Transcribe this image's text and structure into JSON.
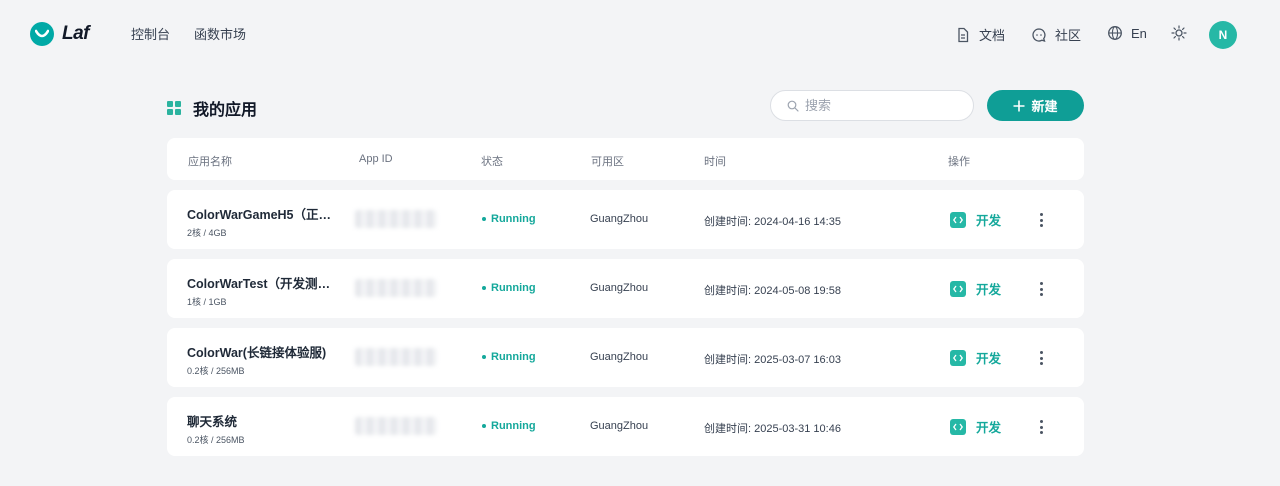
{
  "brand": {
    "name": "Laf",
    "accent": "#0f9e96"
  },
  "nav": {
    "console": "控制台",
    "market": "函数市场"
  },
  "right_nav": {
    "docs": "文档",
    "community": "社区",
    "language": "En",
    "avatar_letter": "N"
  },
  "page": {
    "title": "我的应用",
    "search_placeholder": "搜索",
    "new_label": "新建"
  },
  "table": {
    "columns": [
      "应用名称",
      "App ID",
      "状态",
      "可用区",
      "时间",
      "操作"
    ],
    "rows": [
      {
        "name": "ColorWarGameH5（正式...",
        "spec": "2核 / 4GB",
        "status": "Running",
        "region": "GuangZhou",
        "time": "创建时间: 2024-04-16 14:35",
        "action": "开发"
      },
      {
        "name": "ColorWarTest（开发测试...",
        "spec": "1核 / 1GB",
        "status": "Running",
        "region": "GuangZhou",
        "time": "创建时间: 2024-05-08 19:58",
        "action": "开发"
      },
      {
        "name": "ColorWar(长链接体验服)",
        "spec": "0.2核 / 256MB",
        "status": "Running",
        "region": "GuangZhou",
        "time": "创建时间: 2025-03-07 16:03",
        "action": "开发"
      },
      {
        "name": "聊天系统",
        "spec": "0.2核 / 256MB",
        "status": "Running",
        "region": "GuangZhou",
        "time": "创建时间: 2025-03-31 10:46",
        "action": "开发"
      }
    ]
  }
}
